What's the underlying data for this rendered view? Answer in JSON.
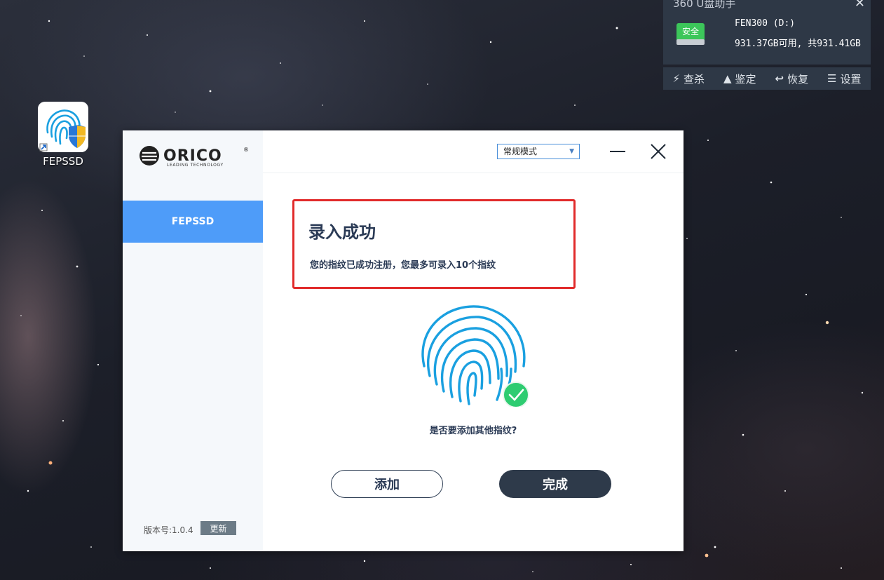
{
  "desktop": {
    "icon_label": "FEPSSD"
  },
  "widget360": {
    "title": "360 U盘助手",
    "status_badge": "安全",
    "drive_line": "FEN300 (D:)",
    "capacity_line": "931.37GB可用, 共931.41GB",
    "actions": [
      {
        "label": "查杀",
        "icon": "bolt-icon"
      },
      {
        "label": "鉴定",
        "icon": "stamp-icon"
      },
      {
        "label": "恢复",
        "icon": "restore-icon"
      },
      {
        "label": "设置",
        "icon": "list-icon"
      }
    ]
  },
  "app": {
    "brand": "ORICO",
    "brand_tagline": "LEADING TECHNOLOGY",
    "sidebar": {
      "items": [
        {
          "label": "FEPSSD",
          "active": true
        }
      ]
    },
    "version_label": "版本号:1.0.4",
    "update_label": "更新",
    "mode_select": {
      "selected": "常规模式"
    },
    "notice": {
      "title": "录入成功",
      "message": "您的指纹已成功注册，您最多可录入10个指纹"
    },
    "question": "是否要添加其他指纹?",
    "add_label": "添加",
    "done_label": "完成"
  },
  "colors": {
    "sidebar_active": "#4e9cf9",
    "highlight_border": "#e12b2b",
    "fingerprint": "#1aa0e0",
    "success_check": "#2ecc71",
    "done_button": "#2e3a4a"
  }
}
